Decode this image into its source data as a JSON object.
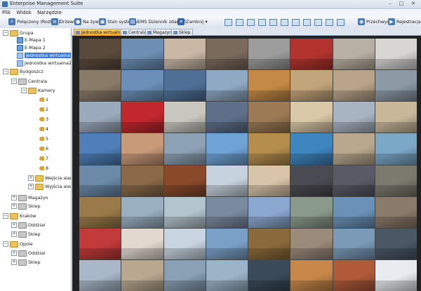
{
  "window": {
    "title": "Enterprise Management Suite",
    "controls": [
      "–",
      "□",
      "✕"
    ]
  },
  "menu": [
    "Plik",
    "Widok",
    "Narzędzie"
  ],
  "toolbar": {
    "connected": "Połączony (Rozłącz)",
    "tree": "Drzewo",
    "live": "Na żywo",
    "system_status": "Stan systemu",
    "event_log": "EMS Dziennik zdarzeń",
    "close": "Zamknij",
    "preview": "Przechwyć",
    "record": "Rejestracja"
  },
  "tree": {
    "grupa": "Grupa",
    "emapa1": "E-Mapa 1",
    "emapa2": "E-Mapa 2",
    "ju1": "Jednostka wirtualna1",
    "ju2": "Jednostka wirtualna2",
    "bydgoszcz": "Bydgoszcz",
    "centrala": "Centrala",
    "kamery": "Kamery",
    "cams": [
      "1",
      "2",
      "3",
      "4",
      "5",
      "6",
      "7",
      "8"
    ],
    "wejscia": "Wejścia alarmowe",
    "wyjscia": "Wyjścia alarmowe",
    "magazyn": "Magazyn",
    "sklep": "Sklep",
    "krakow": "Kraków",
    "oddzial": "Oddział",
    "sklep2": "Sklep",
    "opole": "Opole",
    "oddzial2": "Oddział",
    "sklep3": "Sklep"
  },
  "tabs": [
    "Jednostka wirtualna1",
    "Centrala",
    "Magazyn",
    "Sklep"
  ],
  "colors": {
    "tiles": [
      "#5a4a3a",
      "#6d8fb3",
      "#c9b8a6",
      "#7a6a5c",
      "#9c9c9c",
      "#b3342e",
      "#b8b0a2",
      "#d8d6d2",
      "#8a7a68",
      "#6b8fb8",
      "#4e6f96",
      "#8fa8c4",
      "#c48a45",
      "#c2a47a",
      "#b9a489",
      "#8c9aa6",
      "#9aa9bb",
      "#c2272e",
      "#c8c8c0",
      "#5e6f8a",
      "#9b7a55",
      "#d8c8a8",
      "#a8b4c2",
      "#c8b89a",
      "#4f7fb8",
      "#c99a7a",
      "#8da2b5",
      "#6fa3d6",
      "#b58e4e",
      "#3e86c0",
      "#b9a88e",
      "#7ca8c8",
      "#6a8aa8",
      "#8a6a48",
      "#8a4a2a",
      "#c6d2de",
      "#d8c4a8",
      "#4a4a52",
      "#5a5a66",
      "#7a7a6e",
      "#9a7a48",
      "#9ab0c0",
      "#b4c4cc",
      "#7a8aa0",
      "#8aa8d0",
      "#8a9a8a",
      "#6a92b8",
      "#8a7a6a",
      "#c23a3a",
      "#e2d8d0",
      "#c8d4e0",
      "#7aa0c8",
      "#8a6a3a",
      "#9a8a7a",
      "#7a9ab8",
      "#4a5866",
      "#a8b8c8",
      "#b8a890",
      "#8aa0b4",
      "#9cb4c8",
      "#3a4a58",
      "#c8884a",
      "#b05a3a",
      "#e8ecf0"
    ]
  }
}
